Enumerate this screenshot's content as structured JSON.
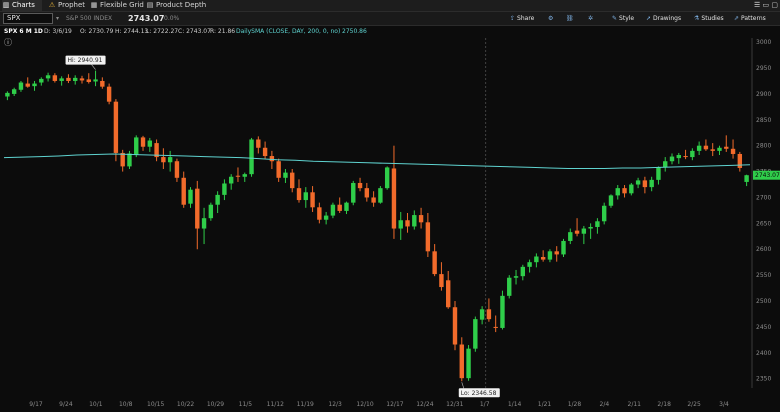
{
  "tabs": [
    {
      "label": "Charts",
      "icon": "chart-icon",
      "active": true
    },
    {
      "label": "Prophet",
      "icon": "warning-icon",
      "active": false
    },
    {
      "label": "Flexible Grid",
      "icon": "grid-icon",
      "active": false
    },
    {
      "label": "Product Depth",
      "icon": "depth-icon",
      "active": false
    }
  ],
  "symbol_bar": {
    "symbol": "SPX",
    "name": "S&P 500 INDEX",
    "last": "2743.07",
    "change": "0.0%"
  },
  "toolbar": [
    {
      "label": "Share",
      "icon": "share-icon"
    },
    {
      "label": "",
      "icon": "settings-icon"
    },
    {
      "label": "",
      "icon": "link-icon"
    },
    {
      "label": "",
      "icon": "gear-icon"
    },
    {
      "label": "Style",
      "icon": "style-icon"
    },
    {
      "label": "Drawings",
      "icon": "pencil-icon"
    },
    {
      "label": "Studies",
      "icon": "flask-icon"
    },
    {
      "label": "Patterns",
      "icon": "pattern-icon"
    }
  ],
  "study_line": {
    "title": "SPX 6 M 1D",
    "date": "D: 3/6/19",
    "open": "O: 2730.79",
    "high": "H: 2744.13",
    "low": "L: 2722.27",
    "close": "C: 2743.07",
    "range": "R: 21.86",
    "sma_label": "DailySMA (CLOSE, DAY, 200, 0, no)",
    "sma_value": "2750.86"
  },
  "chart_data": {
    "type": "candlestick",
    "x_labels": [
      "9/17",
      "9/24",
      "10/1",
      "10/8",
      "10/15",
      "10/22",
      "10/29",
      "11/5",
      "11/12",
      "11/19",
      "12/3",
      "12/10",
      "12/17",
      "12/24",
      "12/31",
      "1/7",
      "1/14",
      "1/21",
      "1/28",
      "2/4",
      "2/11",
      "2/18",
      "2/25",
      "3/4"
    ],
    "y_ticks": [
      2350,
      2400,
      2450,
      2500,
      2550,
      2600,
      2650,
      2700,
      2750,
      2800,
      2850,
      2900,
      2950,
      3000
    ],
    "ylim": [
      2332,
      3008
    ],
    "hi_label": "Hi: 2940.91",
    "lo_label": "Lo: 2346.58",
    "price_label": "2743.07",
    "sma": [
      2777,
      2778,
      2779,
      2780,
      2782,
      2783,
      2784,
      2783,
      2782,
      2781,
      2780,
      2779,
      2778,
      2777,
      2775,
      2773,
      2772,
      2770,
      2769,
      2768,
      2767,
      2766,
      2765,
      2764,
      2763,
      2762,
      2761,
      2760,
      2759,
      2758,
      2757,
      2756,
      2756,
      2756,
      2757,
      2757,
      2758,
      2759,
      2760,
      2761,
      2762,
      2763
    ],
    "colors": {
      "up": "#2fce4a",
      "down": "#f26b2b",
      "sma": "#5fd3d0",
      "axis": "#8c8c8c",
      "price_bg": "#2fce4a"
    },
    "candles": [
      [
        2895,
        2905,
        2888,
        2902
      ],
      [
        2900,
        2912,
        2896,
        2909
      ],
      [
        2908,
        2925,
        2904,
        2922
      ],
      [
        2920,
        2932,
        2912,
        2914
      ],
      [
        2915,
        2925,
        2906,
        2920
      ],
      [
        2922,
        2932,
        2916,
        2929
      ],
      [
        2930,
        2941,
        2924,
        2936
      ],
      [
        2936,
        2940,
        2922,
        2925
      ],
      [
        2925,
        2934,
        2916,
        2930
      ],
      [
        2931,
        2938,
        2921,
        2925
      ],
      [
        2925,
        2936,
        2918,
        2931
      ],
      [
        2930,
        2935,
        2920,
        2926
      ],
      [
        2928,
        2940,
        2920,
        2923
      ],
      [
        2924,
        2945,
        2915,
        2928
      ],
      [
        2925,
        2932,
        2910,
        2914
      ],
      [
        2914,
        2920,
        2880,
        2885
      ],
      [
        2885,
        2890,
        2770,
        2786
      ],
      [
        2786,
        2792,
        2750,
        2760
      ],
      [
        2760,
        2790,
        2755,
        2785
      ],
      [
        2783,
        2820,
        2778,
        2816
      ],
      [
        2816,
        2819,
        2790,
        2798
      ],
      [
        2798,
        2815,
        2788,
        2810
      ],
      [
        2805,
        2812,
        2770,
        2778
      ],
      [
        2778,
        2795,
        2755,
        2768
      ],
      [
        2768,
        2790,
        2750,
        2778
      ],
      [
        2770,
        2775,
        2730,
        2738
      ],
      [
        2738,
        2750,
        2680,
        2686
      ],
      [
        2688,
        2720,
        2680,
        2715
      ],
      [
        2717,
        2732,
        2600,
        2640
      ],
      [
        2640,
        2680,
        2610,
        2660
      ],
      [
        2660,
        2690,
        2655,
        2686
      ],
      [
        2686,
        2712,
        2670,
        2705
      ],
      [
        2705,
        2735,
        2695,
        2727
      ],
      [
        2727,
        2745,
        2715,
        2740
      ],
      [
        2742,
        2758,
        2730,
        2740
      ],
      [
        2740,
        2748,
        2730,
        2745
      ],
      [
        2745,
        2815,
        2740,
        2812
      ],
      [
        2812,
        2818,
        2785,
        2796
      ],
      [
        2796,
        2808,
        2775,
        2780
      ],
      [
        2780,
        2790,
        2755,
        2770
      ],
      [
        2770,
        2775,
        2730,
        2738
      ],
      [
        2738,
        2755,
        2728,
        2748
      ],
      [
        2748,
        2755,
        2710,
        2718
      ],
      [
        2718,
        2735,
        2690,
        2695
      ],
      [
        2695,
        2720,
        2680,
        2710
      ],
      [
        2710,
        2722,
        2672,
        2681
      ],
      [
        2681,
        2690,
        2650,
        2657
      ],
      [
        2657,
        2672,
        2648,
        2665
      ],
      [
        2665,
        2690,
        2660,
        2686
      ],
      [
        2686,
        2700,
        2670,
        2674
      ],
      [
        2674,
        2692,
        2668,
        2690
      ],
      [
        2690,
        2732,
        2685,
        2728
      ],
      [
        2728,
        2738,
        2712,
        2718
      ],
      [
        2718,
        2728,
        2692,
        2700
      ],
      [
        2700,
        2712,
        2682,
        2690
      ],
      [
        2690,
        2722,
        2688,
        2718
      ],
      [
        2718,
        2760,
        2715,
        2758
      ],
      [
        2756,
        2800,
        2620,
        2640
      ],
      [
        2640,
        2672,
        2618,
        2656
      ],
      [
        2656,
        2670,
        2632,
        2644
      ],
      [
        2644,
        2675,
        2638,
        2666
      ],
      [
        2666,
        2680,
        2640,
        2652
      ],
      [
        2652,
        2670,
        2585,
        2596
      ],
      [
        2596,
        2610,
        2548,
        2552
      ],
      [
        2552,
        2575,
        2520,
        2527
      ],
      [
        2540,
        2558,
        2485,
        2488
      ],
      [
        2488,
        2500,
        2405,
        2416
      ],
      [
        2416,
        2430,
        2345,
        2351
      ],
      [
        2351,
        2415,
        2346,
        2408
      ],
      [
        2408,
        2470,
        2402,
        2465
      ],
      [
        2464,
        2490,
        2455,
        2484
      ],
      [
        2484,
        2505,
        2460,
        2465
      ],
      [
        2450,
        2472,
        2440,
        2448
      ],
      [
        2448,
        2520,
        2445,
        2510
      ],
      [
        2510,
        2550,
        2505,
        2545
      ],
      [
        2545,
        2560,
        2532,
        2548
      ],
      [
        2548,
        2570,
        2540,
        2566
      ],
      [
        2566,
        2580,
        2555,
        2575
      ],
      [
        2575,
        2592,
        2565,
        2586
      ],
      [
        2585,
        2598,
        2576,
        2580
      ],
      [
        2580,
        2600,
        2575,
        2596
      ],
      [
        2596,
        2606,
        2576,
        2590
      ],
      [
        2590,
        2620,
        2585,
        2616
      ],
      [
        2616,
        2640,
        2610,
        2633
      ],
      [
        2636,
        2660,
        2625,
        2630
      ],
      [
        2630,
        2645,
        2610,
        2640
      ],
      [
        2640,
        2650,
        2620,
        2643
      ],
      [
        2643,
        2660,
        2630,
        2654
      ],
      [
        2654,
        2690,
        2648,
        2684
      ],
      [
        2684,
        2706,
        2680,
        2704
      ],
      [
        2704,
        2724,
        2696,
        2718
      ],
      [
        2718,
        2724,
        2700,
        2708
      ],
      [
        2708,
        2728,
        2704,
        2725
      ],
      [
        2725,
        2738,
        2718,
        2733
      ],
      [
        2733,
        2740,
        2708,
        2720
      ],
      [
        2720,
        2740,
        2712,
        2734
      ],
      [
        2734,
        2760,
        2725,
        2758
      ],
      [
        2758,
        2778,
        2750,
        2770
      ],
      [
        2770,
        2785,
        2764,
        2779
      ],
      [
        2776,
        2786,
        2765,
        2782
      ],
      [
        2780,
        2792,
        2774,
        2778
      ],
      [
        2778,
        2795,
        2772,
        2790
      ],
      [
        2790,
        2808,
        2782,
        2800
      ],
      [
        2800,
        2812,
        2790,
        2793
      ],
      [
        2793,
        2805,
        2780,
        2790
      ],
      [
        2790,
        2800,
        2782,
        2796
      ],
      [
        2798,
        2820,
        2788,
        2794
      ],
      [
        2794,
        2812,
        2775,
        2784
      ],
      [
        2784,
        2788,
        2750,
        2757
      ],
      [
        2730,
        2744,
        2722,
        2743
      ]
    ]
  }
}
